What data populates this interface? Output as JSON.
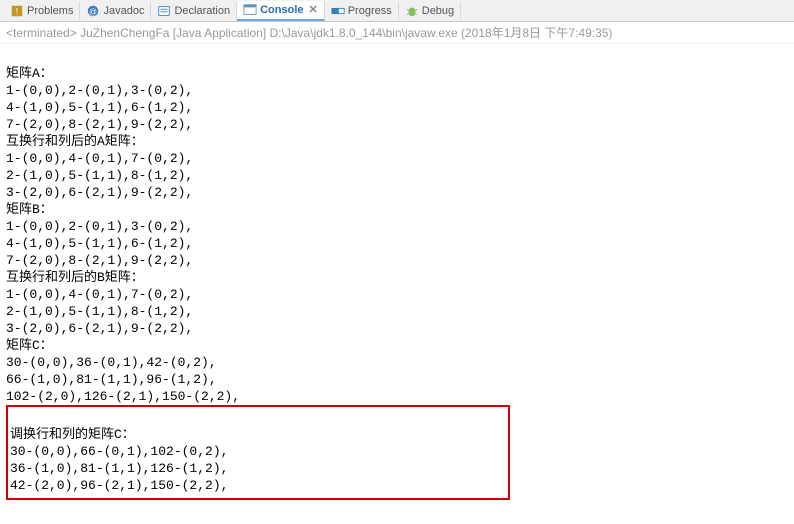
{
  "tabs": {
    "problems": {
      "label": "Problems"
    },
    "javadoc": {
      "label": "Javadoc"
    },
    "declaration": {
      "label": "Declaration"
    },
    "console": {
      "label": "Console"
    },
    "progress": {
      "label": "Progress"
    },
    "debug": {
      "label": "Debug"
    }
  },
  "status": {
    "terminated_prefix": "<terminated>",
    "run_name": "JuZhenChengFa",
    "run_type": "[Java Application]",
    "exe_path": "D:\\Java\\jdk1.8.0_144\\bin\\javaw.exe",
    "timestamp": "(2018年1月8日 下午7:49:35)"
  },
  "console_lines": [
    "矩阵A：",
    "1-(0,0),2-(0,1),3-(0,2),",
    "4-(1,0),5-(1,1),6-(1,2),",
    "7-(2,0),8-(2,1),9-(2,2),",
    "互换行和列后的A矩阵：",
    "1-(0,0),4-(0,1),7-(0,2),",
    "2-(1,0),5-(1,1),8-(1,2),",
    "3-(2,0),6-(2,1),9-(2,2),",
    "矩阵B：",
    "1-(0,0),2-(0,1),3-(0,2),",
    "4-(1,0),5-(1,1),6-(1,2),",
    "7-(2,0),8-(2,1),9-(2,2),",
    "互换行和列后的B矩阵：",
    "1-(0,0),4-(0,1),7-(0,2),",
    "2-(1,0),5-(1,1),8-(1,2),",
    "3-(2,0),6-(2,1),9-(2,2),",
    "矩阵C：",
    "30-(0,0),36-(0,1),42-(0,2),",
    "66-(1,0),81-(1,1),96-(1,2),",
    "102-(2,0),126-(2,1),150-(2,2),"
  ],
  "highlight_lines": [
    "调换行和列的矩阵C：",
    "30-(0,0),66-(0,1),102-(0,2),",
    "36-(1,0),81-(1,1),126-(1,2),",
    "42-(2,0),96-(2,1),150-(2,2),"
  ]
}
